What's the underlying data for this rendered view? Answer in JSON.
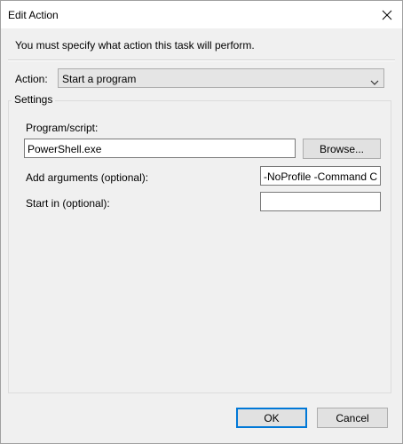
{
  "window": {
    "title": "Edit Action"
  },
  "instruction": "You must specify what action this task will perform.",
  "action": {
    "label": "Action:",
    "selected": "Start a program"
  },
  "settings": {
    "legend": "Settings",
    "program_label": "Program/script:",
    "program_value": "PowerShell.exe",
    "browse_label": "Browse...",
    "arguments_label": "Add arguments (optional):",
    "arguments_value": "-NoProfile -Command C",
    "startin_label": "Start in (optional):",
    "startin_value": ""
  },
  "footer": {
    "ok_label": "OK",
    "cancel_label": "Cancel"
  },
  "colors": {
    "default_button_border": "#0078d7",
    "window_background": "#f0f0f0"
  },
  "icons": {
    "close": "close-icon",
    "dropdown": "chevron-down-icon"
  }
}
